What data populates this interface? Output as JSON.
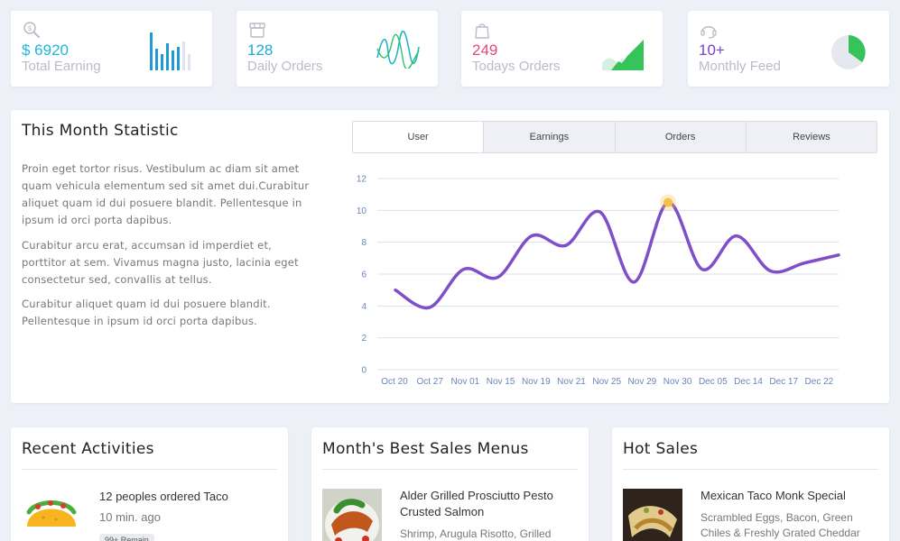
{
  "stats": [
    {
      "value": "$ 6920",
      "label": "Total Earning",
      "color": "#1fb6d9",
      "icon": "search-dollar-icon"
    },
    {
      "value": "128",
      "label": "Daily Orders",
      "color": "#1fa8d9",
      "icon": "store-icon"
    },
    {
      "value": "249",
      "label": "Todays Orders",
      "color": "#e4457f",
      "icon": "shopping-bag-icon"
    },
    {
      "value": "10+",
      "label": "Monthly Feed",
      "color": "#7a3fd0",
      "icon": "headset-icon"
    }
  ],
  "statistic": {
    "title": "This Month Statistic",
    "paragraphs": [
      "Proin eget tortor risus. Vestibulum ac diam sit amet quam vehicula elementum sed sit amet dui.Curabitur aliquet quam id dui posuere blandit. Pellentesque in ipsum id orci porta dapibus.",
      "Curabitur arcu erat, accumsan id imperdiet et, porttitor at sem. Vivamus magna justo, lacinia eget consectetur sed, convallis at tellus.",
      "Curabitur aliquet quam id dui posuere blandit. Pellentesque in ipsum id orci porta dapibus."
    ],
    "tabs": [
      "User",
      "Earnings",
      "Orders",
      "Reviews"
    ],
    "active_tab": "User"
  },
  "chart_data": {
    "type": "line",
    "x": [
      "Oct 20",
      "Oct 27",
      "Nov 01",
      "Nov 15",
      "Nov 19",
      "Nov 21",
      "Nov 25",
      "Nov 29",
      "Nov 30",
      "Dec 05",
      "Dec 14",
      "Dec 17",
      "Dec 22"
    ],
    "y": [
      5,
      3.9,
      6.3,
      5.8,
      8.4,
      7.8,
      9.9,
      5.5,
      10.5,
      6.3,
      8.4,
      6.2,
      6.7,
      7.2
    ],
    "highlight_index": 8,
    "ylim": [
      0,
      12
    ],
    "yticks": [
      "0",
      "2",
      "4",
      "6",
      "8",
      "10",
      "12"
    ],
    "grid": true,
    "line_color": "#7e4fc8",
    "highlight_color": "#f5c04a"
  },
  "recent": {
    "title": "Recent Activities",
    "item_title": "12 peoples ordered Taco",
    "item_time": "10 min. ago",
    "badge": "99+ Remain"
  },
  "best": {
    "title": "Month's Best Sales Menus",
    "item_title": "Alder Grilled Prosciutto Pesto Crusted Salmon",
    "item_desc": "Shrimp, Arugula Risotto, Grilled White"
  },
  "hot": {
    "title": "Hot Sales",
    "item_title": "Mexican Taco Monk Special",
    "item_desc": "Scrambled Eggs, Bacon, Green Chiles & Freshly Grated Cheddar Jack"
  }
}
